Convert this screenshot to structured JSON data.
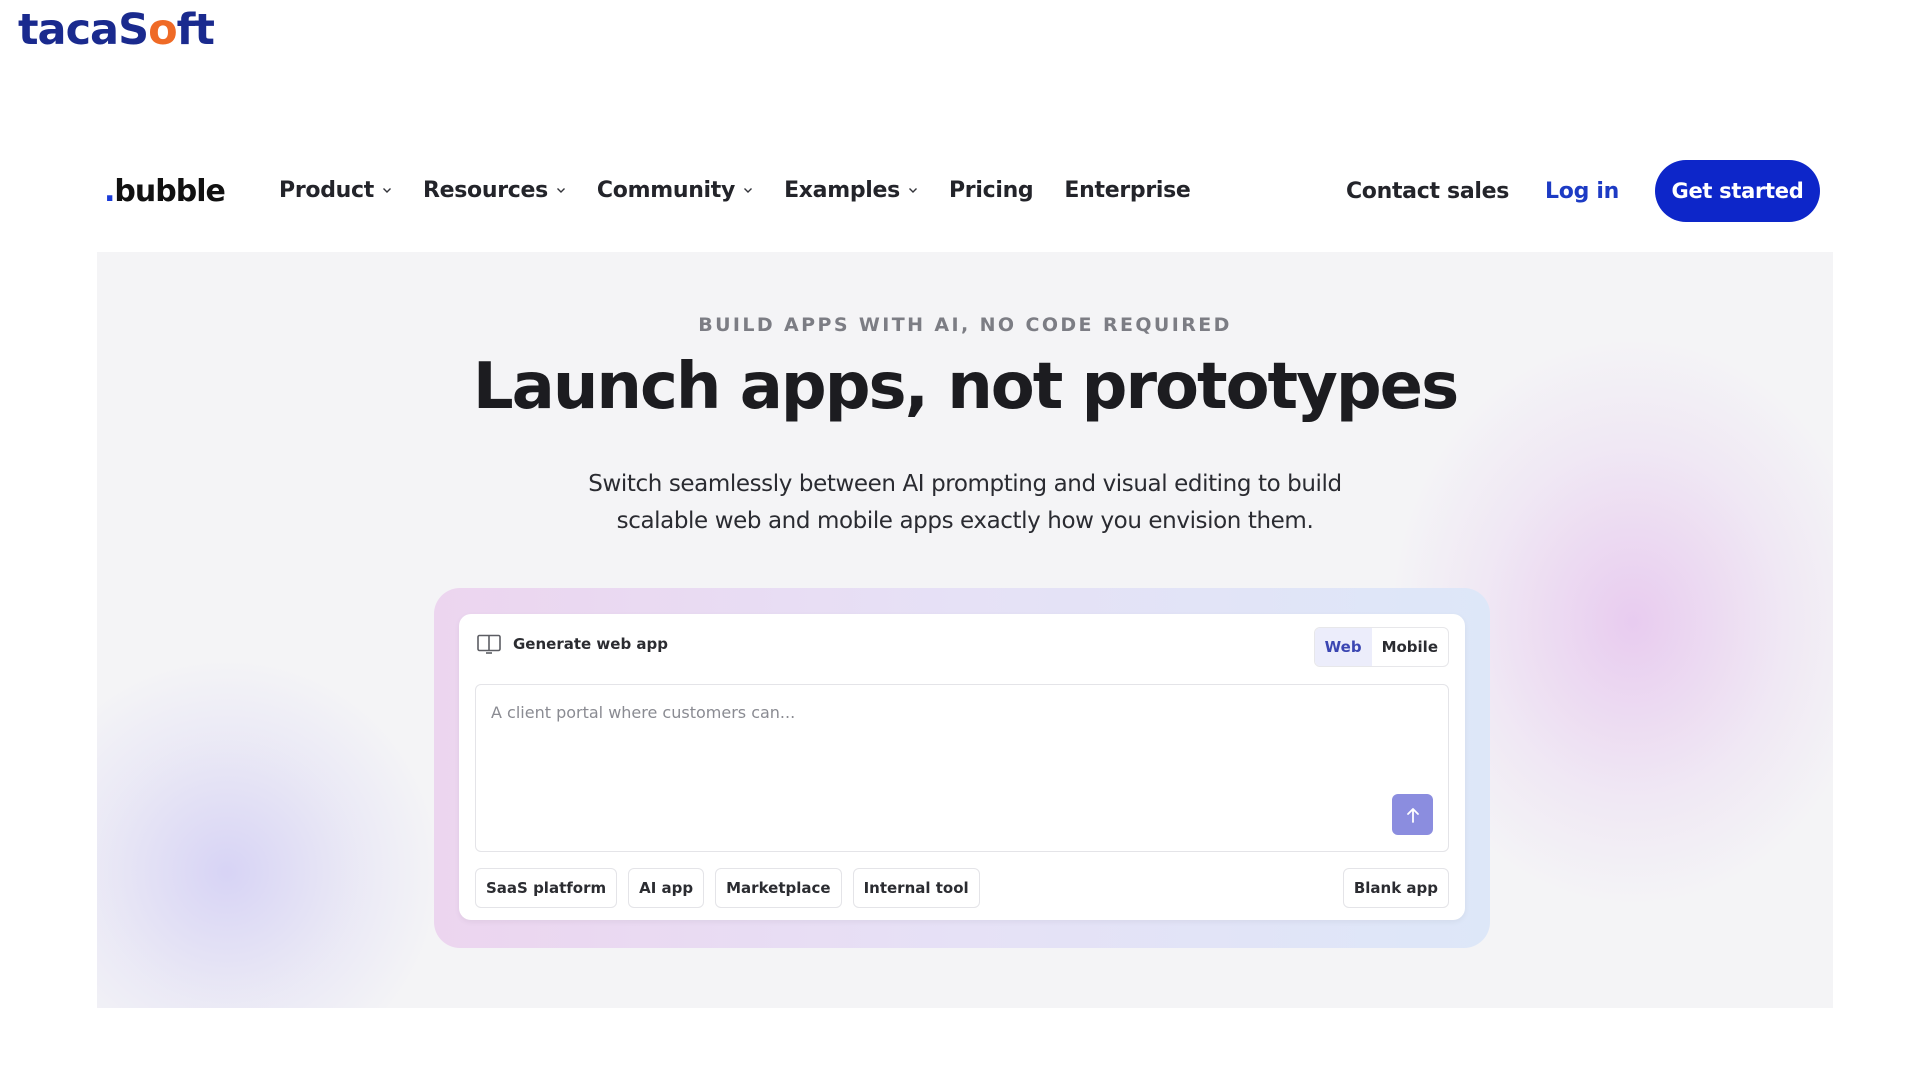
{
  "watermark": {
    "logo_text_pre": "taca",
    "logo_text_s": "S",
    "logo_text_o": "o",
    "logo_text_post": "ft"
  },
  "nav": {
    "brand": {
      "dot": ".",
      "name": "bubble"
    },
    "items": [
      {
        "label": "Product",
        "dropdown": true
      },
      {
        "label": "Resources",
        "dropdown": true
      },
      {
        "label": "Community",
        "dropdown": true
      },
      {
        "label": "Examples",
        "dropdown": true
      },
      {
        "label": "Pricing",
        "dropdown": false
      },
      {
        "label": "Enterprise",
        "dropdown": false
      }
    ],
    "contact_sales": "Contact sales",
    "log_in": "Log in",
    "get_started": "Get started"
  },
  "hero": {
    "eyebrow": "BUILD APPS WITH AI, NO CODE REQUIRED",
    "headline": "Launch apps, not prototypes",
    "sub_line1": "Switch seamlessly between AI prompting and visual editing to build",
    "sub_line2": "scalable web and mobile apps exactly how you envision them."
  },
  "generator": {
    "title": "Generate web app",
    "icon": "browser-window-icon",
    "toggle": [
      {
        "label": "Web",
        "active": true
      },
      {
        "label": "Mobile",
        "active": false
      }
    ],
    "prompt_placeholder": "A client portal where customers can...",
    "send_icon": "arrow-up-icon",
    "chips": [
      "SaaS platform",
      "AI app",
      "Marketplace",
      "Internal tool"
    ],
    "blank_app": "Blank app"
  },
  "colors": {
    "primary": "#0d26c9",
    "login_link": "#1d3bc4",
    "send_button": "#8b8ddf",
    "toggle_active_bg": "#ecedfb"
  }
}
